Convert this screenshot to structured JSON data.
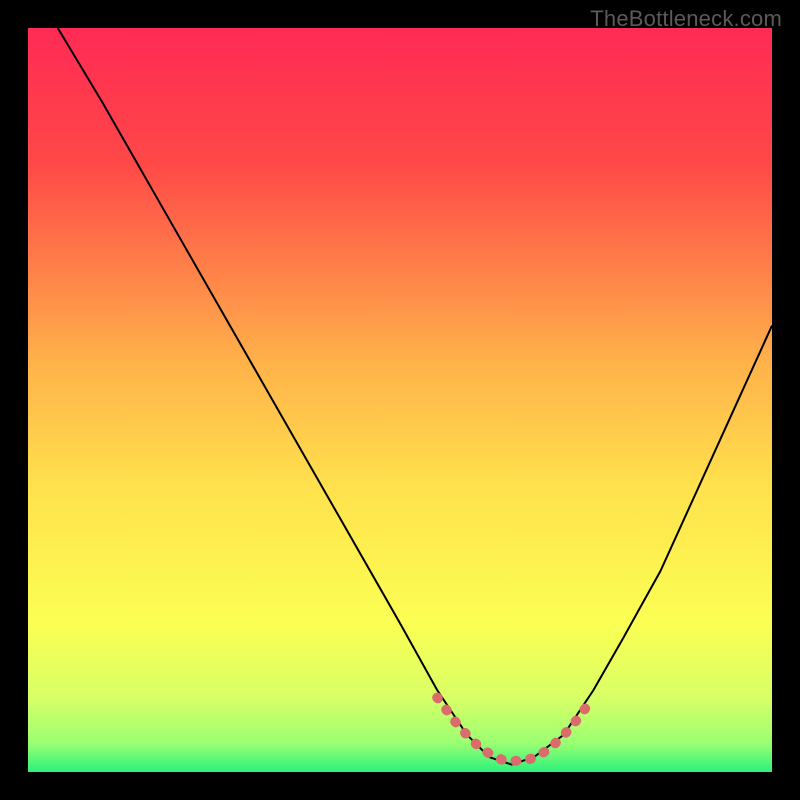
{
  "watermark": "TheBottleneck.com",
  "chart_data": {
    "type": "line",
    "title": "",
    "xlabel": "",
    "ylabel": "",
    "xlim": [
      0,
      100
    ],
    "ylim": [
      0,
      100
    ],
    "grid": false,
    "legend": false,
    "gradient_stops": [
      {
        "offset": 0.0,
        "color": "#ff2a55"
      },
      {
        "offset": 0.18,
        "color": "#ff4848"
      },
      {
        "offset": 0.45,
        "color": "#ffb24a"
      },
      {
        "offset": 0.62,
        "color": "#ffe24d"
      },
      {
        "offset": 0.8,
        "color": "#fbff53"
      },
      {
        "offset": 0.9,
        "color": "#d8ff66"
      },
      {
        "offset": 0.96,
        "color": "#9dff72"
      },
      {
        "offset": 1.0,
        "color": "#2cf27c"
      }
    ],
    "series": [
      {
        "name": "curve",
        "stroke": "#000000",
        "stroke_width": 2,
        "x": [
          4,
          10,
          18,
          26,
          34,
          42,
          50,
          55,
          59,
          62,
          65,
          68,
          72,
          76,
          80,
          85,
          90,
          95,
          100
        ],
        "y": [
          100,
          90,
          76,
          62,
          48,
          34,
          20,
          11,
          5,
          2,
          1,
          2,
          5,
          11,
          18,
          27,
          38,
          49,
          60
        ]
      },
      {
        "name": "trough-marker",
        "stroke": "#da6d6c",
        "stroke_width": 10,
        "linecap": "round",
        "dash": [
          1,
          14
        ],
        "x": [
          55,
          58,
          61,
          64,
          67,
          70,
          73,
          76
        ],
        "y": [
          10,
          6,
          3,
          1.5,
          1.5,
          3,
          6,
          10
        ]
      }
    ]
  }
}
